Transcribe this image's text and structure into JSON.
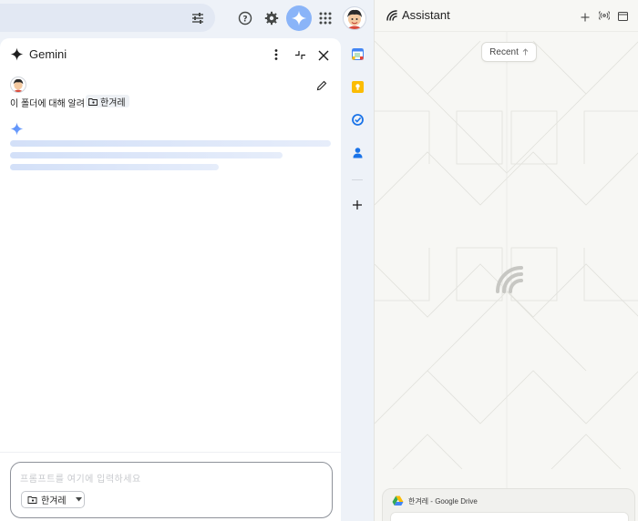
{
  "topbar": {
    "icons": [
      "tune-icon",
      "help-icon",
      "settings-icon",
      "gemini-icon",
      "apps-grid-icon",
      "avatar"
    ]
  },
  "gemini_panel": {
    "title": "Gemini",
    "prompt_text": "이 폴더에 대해 알려 줘",
    "folder_chip": "한겨레",
    "input_placeholder": "프롬프트를 여기에 입력하세요",
    "source_dropdown": "한겨레"
  },
  "side_rail": {
    "icons": [
      "calendar-icon",
      "keep-icon",
      "tasks-icon",
      "contacts-icon",
      "add-icon"
    ]
  },
  "assistant": {
    "title": "Assistant",
    "recent_label": "Recent",
    "drive_card_label": "한겨레 - Google Drive"
  },
  "colors": {
    "accent": "#8ab4f8",
    "loader": "#d3e0f8",
    "background": "#eef2f8"
  }
}
